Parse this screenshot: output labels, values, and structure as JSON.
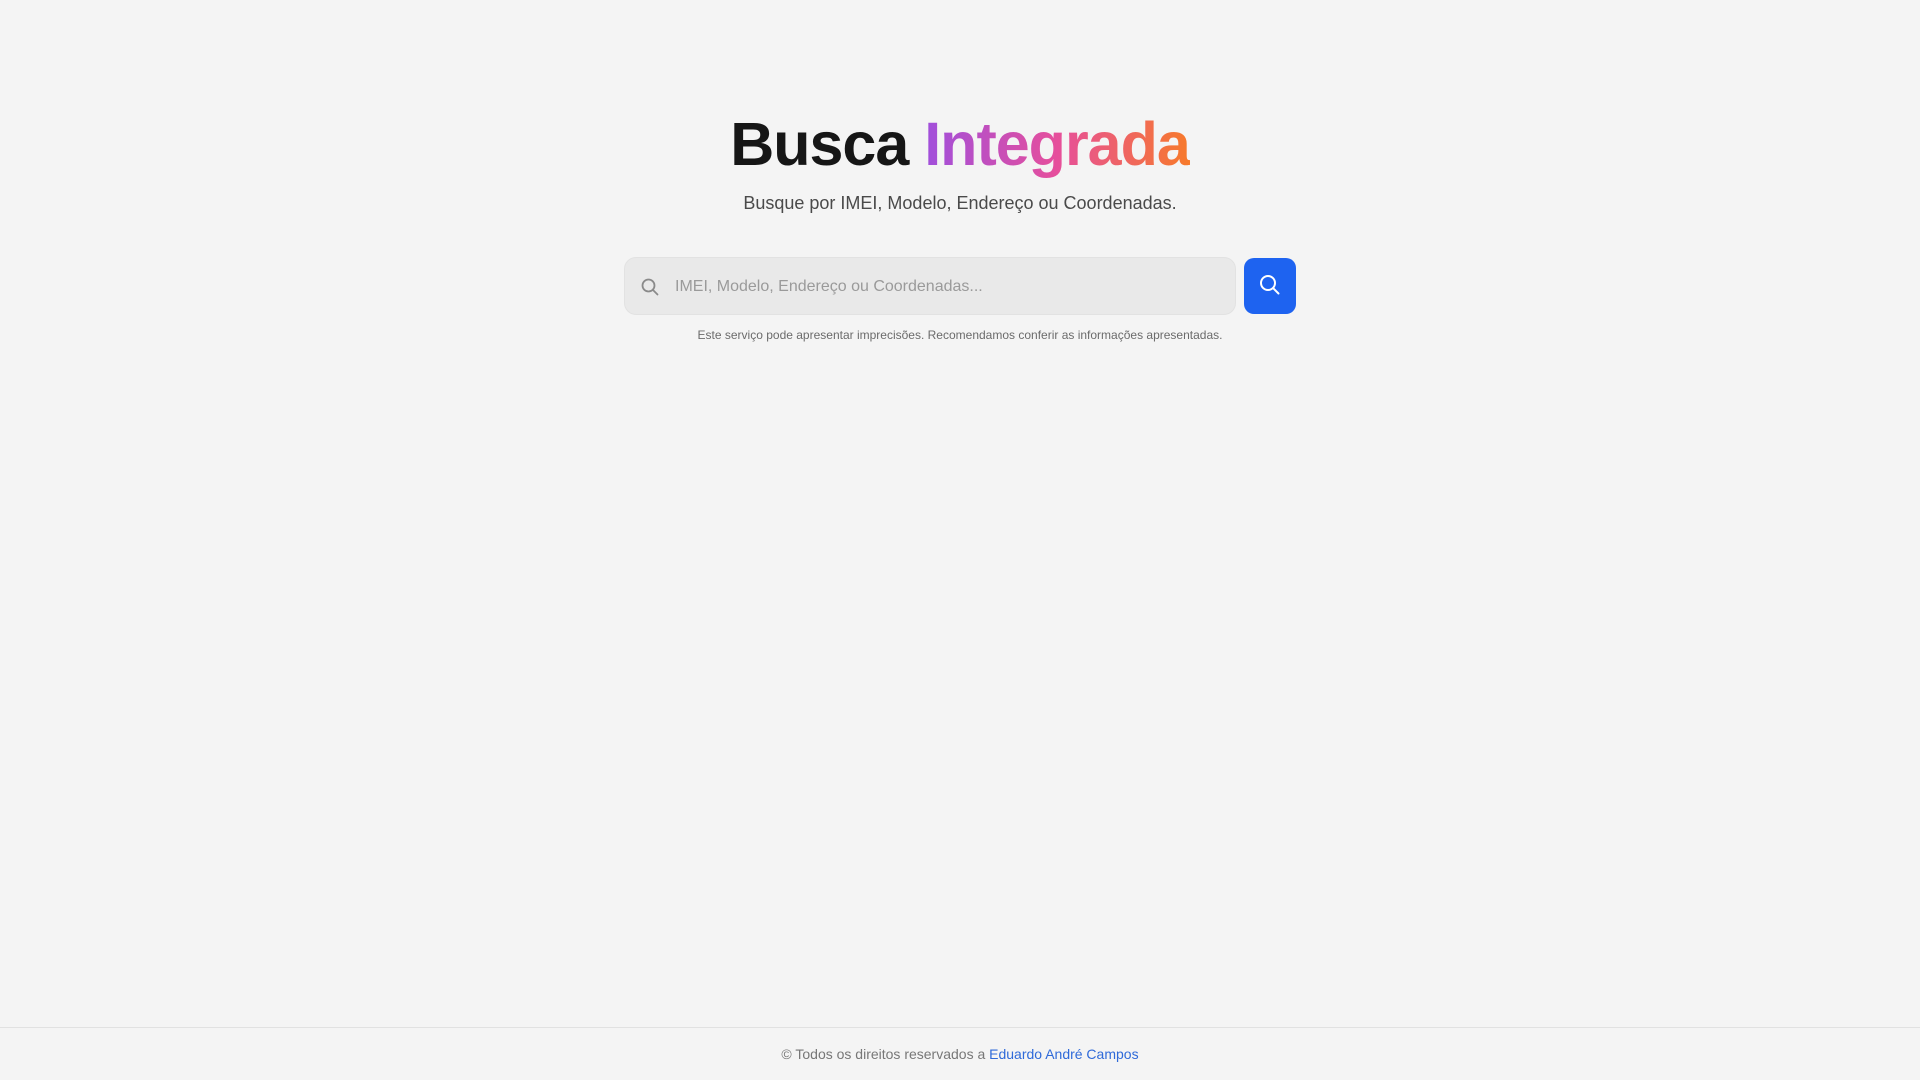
{
  "hero": {
    "title_main": "Busca",
    "title_accent": "Integrada",
    "subtitle": "Busque por IMEI, Modelo, Endereço ou Coordenadas.",
    "accent_gradient": [
      "#a04fdc",
      "#e64f9c",
      "#f77a2a"
    ]
  },
  "search": {
    "value": "",
    "placeholder": "IMEI, Modelo, Endereço ou Coordenadas...",
    "input_icon": "search-icon",
    "button_icon": "search-icon",
    "button_color": "#1e63f0"
  },
  "disclaimer": "Este serviço pode apresentar imprecisões. Recomendamos conferir as informações apresentadas.",
  "footer": {
    "text": "© Todos os direitos reservados a",
    "link_label": "Eduardo André Campos",
    "link_color": "#2f6ad9"
  },
  "colors": {
    "background": "#f4f4f4"
  }
}
